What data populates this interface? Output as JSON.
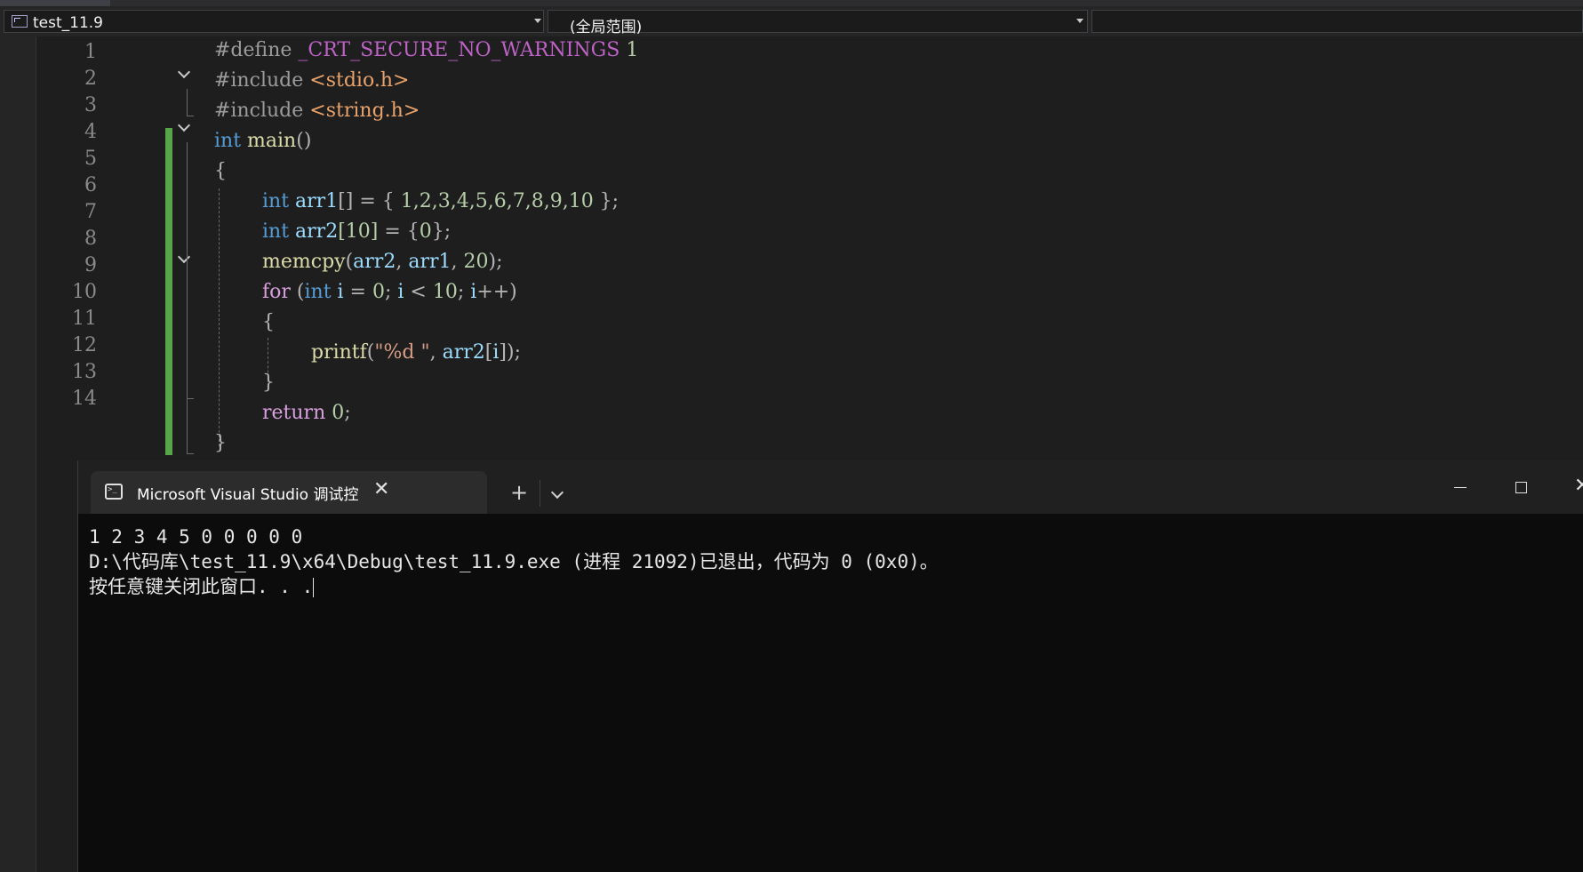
{
  "nav": {
    "project": "test_11.9",
    "scope": "(全局范围)"
  },
  "editor": {
    "lines": [
      {
        "num": "1"
      },
      {
        "num": "2"
      },
      {
        "num": "3"
      },
      {
        "num": "4"
      },
      {
        "num": "5"
      },
      {
        "num": "6"
      },
      {
        "num": "7"
      },
      {
        "num": "8"
      },
      {
        "num": "9"
      },
      {
        "num": "10"
      },
      {
        "num": "11"
      },
      {
        "num": "12"
      },
      {
        "num": "13"
      },
      {
        "num": "14"
      }
    ],
    "code": {
      "l1_pp": "#define",
      "l1_macro": "_CRT_SECURE_NO_WARNINGS",
      "l1_val": "1",
      "l2_pp": "#include",
      "l2_hdr": "<stdio.h>",
      "l3_pp": "#include",
      "l3_hdr": "<string.h>",
      "l4_kw": "int",
      "l4_fn": "main",
      "l4_rest": "()",
      "l5": "{",
      "l6_kw": "int",
      "l6_var": "arr1",
      "l6_mid": "[] = { ",
      "l6_nums": "1,2,3,4,5,6,7,8,9,10",
      "l6_end": " };",
      "l7_kw": "int",
      "l7_var": "arr2",
      "l7_idx": "[10]",
      "l7_mid": " = {",
      "l7_num": "0",
      "l7_end": "};",
      "l8_fn": "memcpy",
      "l8_open": "(",
      "l8_a1": "arr2",
      "l8_c1": ", ",
      "l8_a2": "arr1",
      "l8_c2": ", ",
      "l8_num": "20",
      "l8_end": ");",
      "l9_ctl": "for",
      "l9_open": " (",
      "l9_kw": "int",
      "l9_var": " i",
      "l9_eq": " = ",
      "l9_n0": "0",
      "l9_s1": "; ",
      "l9_i2": "i",
      "l9_lt": " < ",
      "l9_n10": "10",
      "l9_s2": "; ",
      "l9_i3": "i",
      "l9_end": "++)",
      "l10": "{",
      "l11_fn": "printf",
      "l11_open": "(",
      "l11_str": "\"%d \"",
      "l11_c": ", ",
      "l11_var": "arr2",
      "l11_idx": "[",
      "l11_i": "i",
      "l11_end": "]);",
      "l12": "}",
      "l13_ctl": "return",
      "l13_num": " 0",
      "l13_end": ";",
      "l14": "}"
    }
  },
  "terminal": {
    "tab_title": "Microsoft Visual Studio 调试控",
    "close_glyph": "✕",
    "new_tab_glyph": "+",
    "win_close_glyph": "✕",
    "output": [
      "1 2 3 4 5 0 0 0 0 0",
      "D:\\代码库\\test_11.9\\x64\\Debug\\test_11.9.exe (进程 21092)已退出，代码为 0 (0x0)。",
      "按任意键关闭此窗口. . ."
    ]
  },
  "colors": {
    "editor_bg": "#1e1e1e",
    "keyword": "#569cd6",
    "function": "#dcdcaa",
    "variable": "#9cdcfe",
    "number": "#b5cea8",
    "string": "#d69d85",
    "change_bar": "#57a64a",
    "terminal_bg": "#0c0c0c"
  }
}
